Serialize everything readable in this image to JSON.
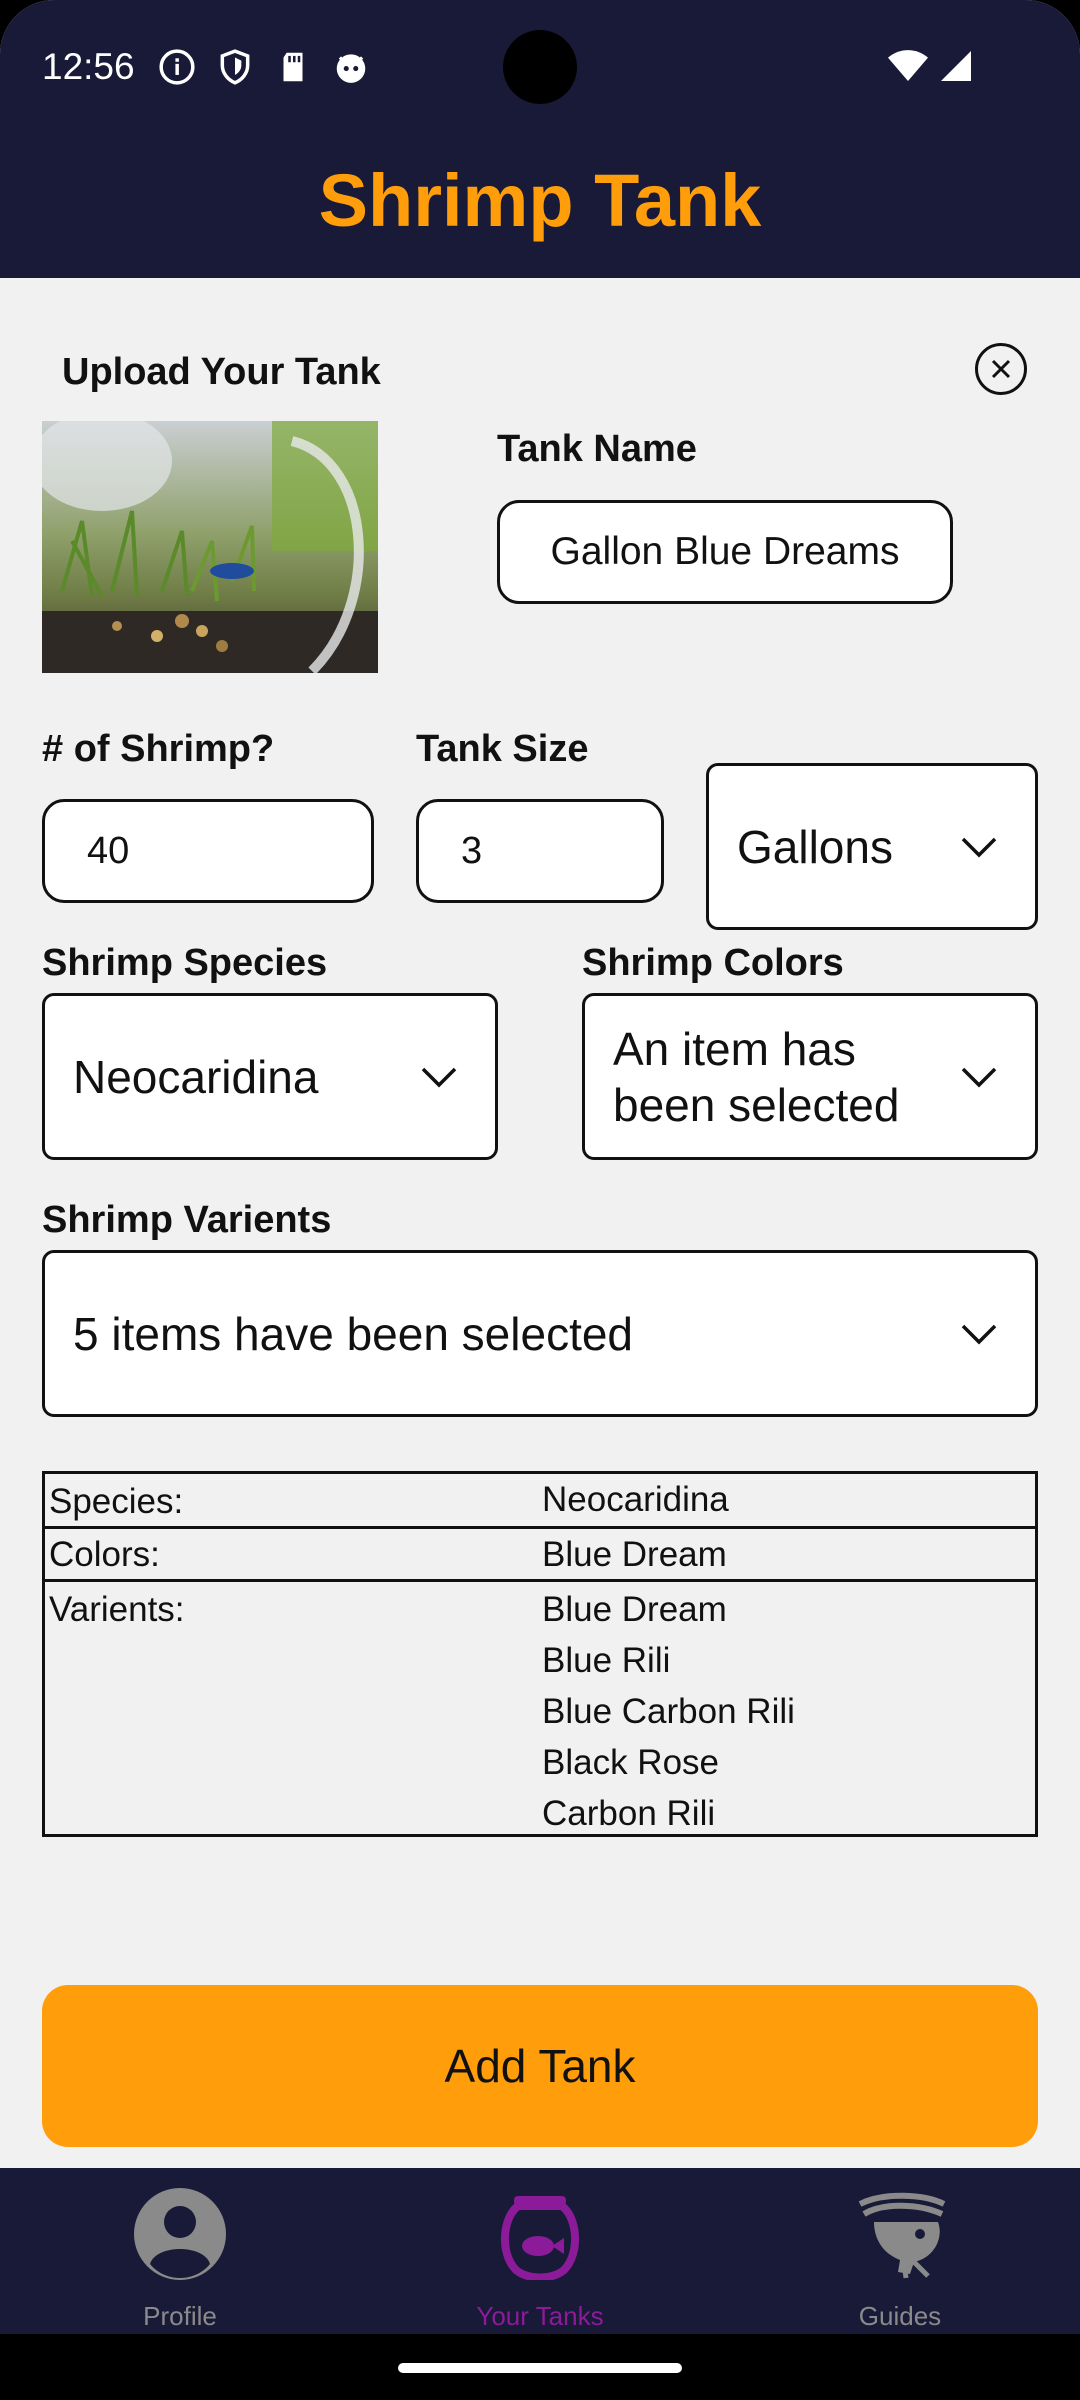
{
  "status_bar": {
    "time": "12:56"
  },
  "app": {
    "title": "Shrimp Tank"
  },
  "upload": {
    "label": "Upload Your Tank"
  },
  "tank_name": {
    "label": "Tank Name",
    "value": "Gallon Blue Dreams"
  },
  "shrimp_count": {
    "label": "# of Shrimp?",
    "value": "40"
  },
  "tank_size": {
    "label": "Tank Size",
    "value": "3",
    "unit_selected": "Gallons"
  },
  "species": {
    "label": "Shrimp Species",
    "selected": "Neocaridina"
  },
  "colors": {
    "label": "Shrimp Colors",
    "selected": "An item has been selected"
  },
  "varients": {
    "label": "Shrimp Varients",
    "selected": "5 items have been selected"
  },
  "summary": {
    "species_key": "Species:",
    "species_value": "Neocaridina",
    "colors_key": "Colors:",
    "colors_value": "Blue Dream",
    "varients_key": "Varients:",
    "varients_values": [
      "Blue Dream",
      "Blue Rili",
      "Blue Carbon Rili",
      "Black Rose",
      "Carbon Rili"
    ]
  },
  "actions": {
    "add_tank": "Add Tank"
  },
  "nav": {
    "items": [
      {
        "label": "Profile",
        "icon": "profile-icon",
        "active": false
      },
      {
        "label": "Your Tanks",
        "icon": "fishbowl-icon",
        "active": true
      },
      {
        "label": "Guides",
        "icon": "shrimp-icon",
        "active": false
      }
    ]
  },
  "colors_palette": {
    "header": "#181a37",
    "accent": "#ff9d0a",
    "nav_active": "#8c1b9a",
    "nav_inactive": "#8a8a8a"
  }
}
